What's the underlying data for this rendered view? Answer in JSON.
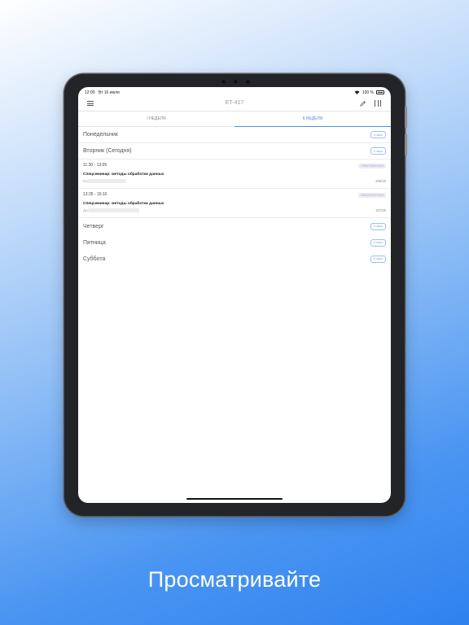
{
  "status_bar": {
    "time": "12:00",
    "date": "Вт 16 июля",
    "battery": "100 %"
  },
  "nav": {
    "title": "ET-417"
  },
  "tabs": [
    {
      "label": "I НЕДЕЛЯ"
    },
    {
      "label": "II НЕДЕЛЯ"
    }
  ],
  "days": {
    "monday": {
      "name": "Понедельник",
      "badge": "4 пары"
    },
    "tuesday": {
      "name": "Вторник (Сегодня)",
      "badge": "2 пары"
    },
    "thursday": {
      "name": "Четверг",
      "badge": "3 пары"
    },
    "friday": {
      "name": "Пятница",
      "badge": "4 пары"
    },
    "saturday": {
      "name": "Суббота",
      "badge": "2 пары"
    }
  },
  "lessons": [
    {
      "time": "11:30 - 13:05",
      "type": "ПРАКТИЧЕСКАЯ",
      "subject": "Спецсеминар: методы обработки данных",
      "teacher": "Бе",
      "room": "206/18"
    },
    {
      "time": "13:35 - 15:10",
      "type": "ЛАБОРАТОРНАЯ",
      "subject": "Спецсеминар: методы обработки данных",
      "teacher": "Ды",
      "room": "327/35"
    }
  ],
  "caption": "Просматривайте",
  "colors": {
    "accent": "#4a90e2",
    "background_top": "#ffffff",
    "background_bottom": "#2f82ef"
  },
  "icons": [
    "menu-icon",
    "pencil-icon",
    "columns-icon",
    "wifi-icon",
    "battery-icon"
  ]
}
